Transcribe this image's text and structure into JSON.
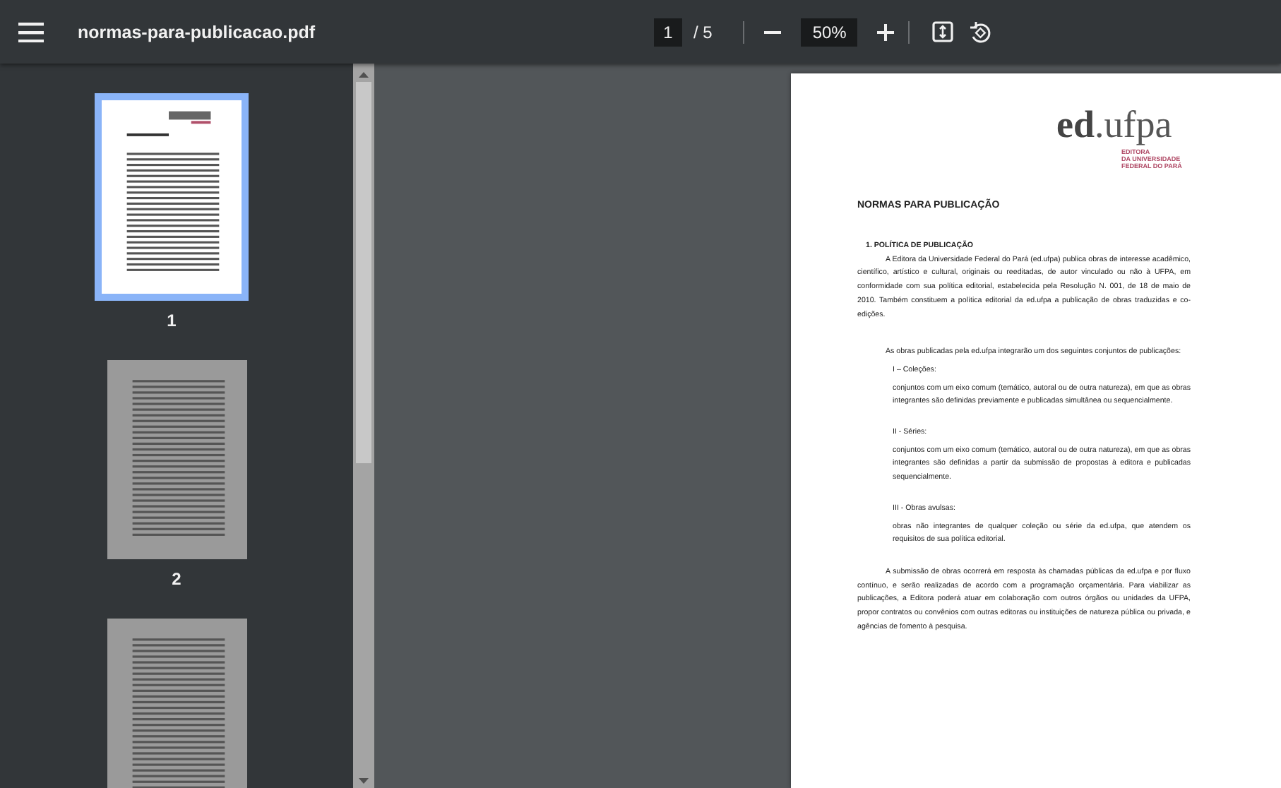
{
  "toolbar": {
    "title": "normas-para-publicacao.pdf",
    "page_field": {
      "value": "1"
    },
    "page_count": "/ 5",
    "zoom_field": {
      "value": "50%"
    }
  },
  "sidebar": {
    "thumbnails": [
      {
        "label": "1",
        "selected": true
      },
      {
        "label": "2",
        "selected": false
      },
      {
        "selected": false
      }
    ]
  },
  "document": {
    "logo": {
      "name": "**ed**.ufpa",
      "subtitle": [
        "EDITORA",
        "DA UNIVERSIDADE",
        "FEDERAL DO PARÁ"
      ]
    },
    "heading": "NORMAS PARA PUBLICAÇÃO",
    "blocks": [
      {
        "kind": "section_heading",
        "text": "1.   POLÍTICA DE PUBLICAÇÃO"
      },
      {
        "kind": "paragraph",
        "text": "A Editora da Universidade Federal do Pará (ed.ufpa) publica obras de interesse acadêmico, científico, artístico e cultural, originais ou reeditadas, de autor vinculado ou não à UFPA, em conformidade com sua política editorial, estabelecida pela Resolução N. 001, de 18 de maio de 2010. Também constituem a política editorial da ed.ufpa a publicação de obras traduzidas e co-edições."
      },
      {
        "kind": "paragraph",
        "text": "As obras publicadas pela ed.ufpa integrarão um dos seguintes conjuntos de publicações:"
      },
      {
        "kind": "item_label",
        "text": "I – Coleções:"
      },
      {
        "kind": "item_text",
        "text": "conjuntos com um eixo comum (temático, autoral ou de outra natureza), em que as obras integrantes são definidas previamente e publicadas simultânea ou sequencialmente."
      },
      {
        "kind": "item_label",
        "text": "II - Séries:"
      },
      {
        "kind": "item_text",
        "text": "conjuntos com um eixo comum (temático, autoral ou de outra natureza), em que as obras integrantes são definidas a partir da submissão de propostas à editora e publicadas sequencialmente."
      },
      {
        "kind": "item_label",
        "text": "III - Obras avulsas:"
      },
      {
        "kind": "item_text",
        "text": "obras não integrantes de qualquer coleção ou série da ed.ufpa, que atendem os requisitos de sua política editorial."
      },
      {
        "kind": "paragraph",
        "text": "A submissão de obras ocorrerá em resposta às chamadas públicas da ed.ufpa e por fluxo contínuo, e serão realizadas de acordo com a programação orçamentária. Para viabilizar as publicações, a Editora poderá atuar em colaboração com outros órgãos ou unidades da UFPA, propor contratos ou convênios com outras editoras ou instituições de natureza pública ou privada, e agências de fomento à pesquisa."
      }
    ]
  }
}
